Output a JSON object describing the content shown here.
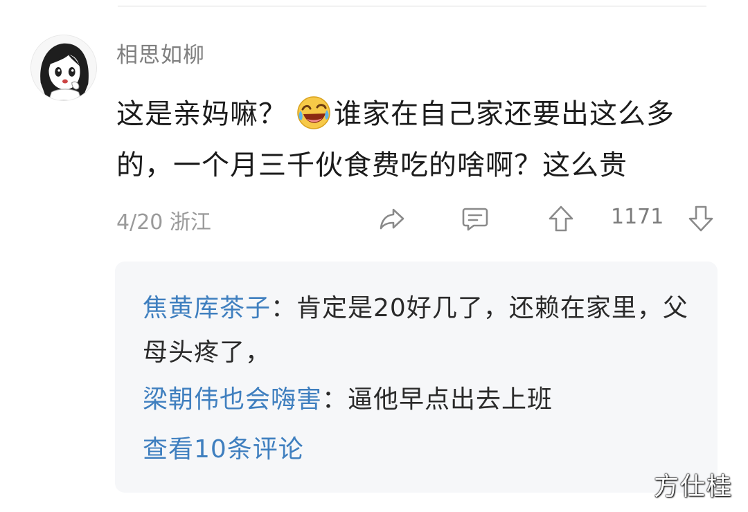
{
  "comment": {
    "username": "相思如柳",
    "text_before_emoji": "这是亲妈嘛？",
    "emoji": "laughing-tears-icon",
    "text_after_emoji": "谁家在自己家还要出这么多的，一个月三千伙食费吃的啥啊？这么贵",
    "meta": "4/20 浙江",
    "vote_count": "1171"
  },
  "replies": [
    {
      "author": "焦黄库茶子",
      "separator": "：",
      "text": "肯定是20好几了，还赖在家里，父母头疼了，"
    },
    {
      "author": "梁朝伟也会嗨害",
      "separator": "：",
      "text": "逼他早点出去上班"
    }
  ],
  "view_more": "查看10条评论",
  "watermark": "方仕桂",
  "colors": {
    "reply_author": "#3f7fbf",
    "reply_box_bg": "#f6f7f9",
    "meta_text": "#9a9a9a"
  }
}
